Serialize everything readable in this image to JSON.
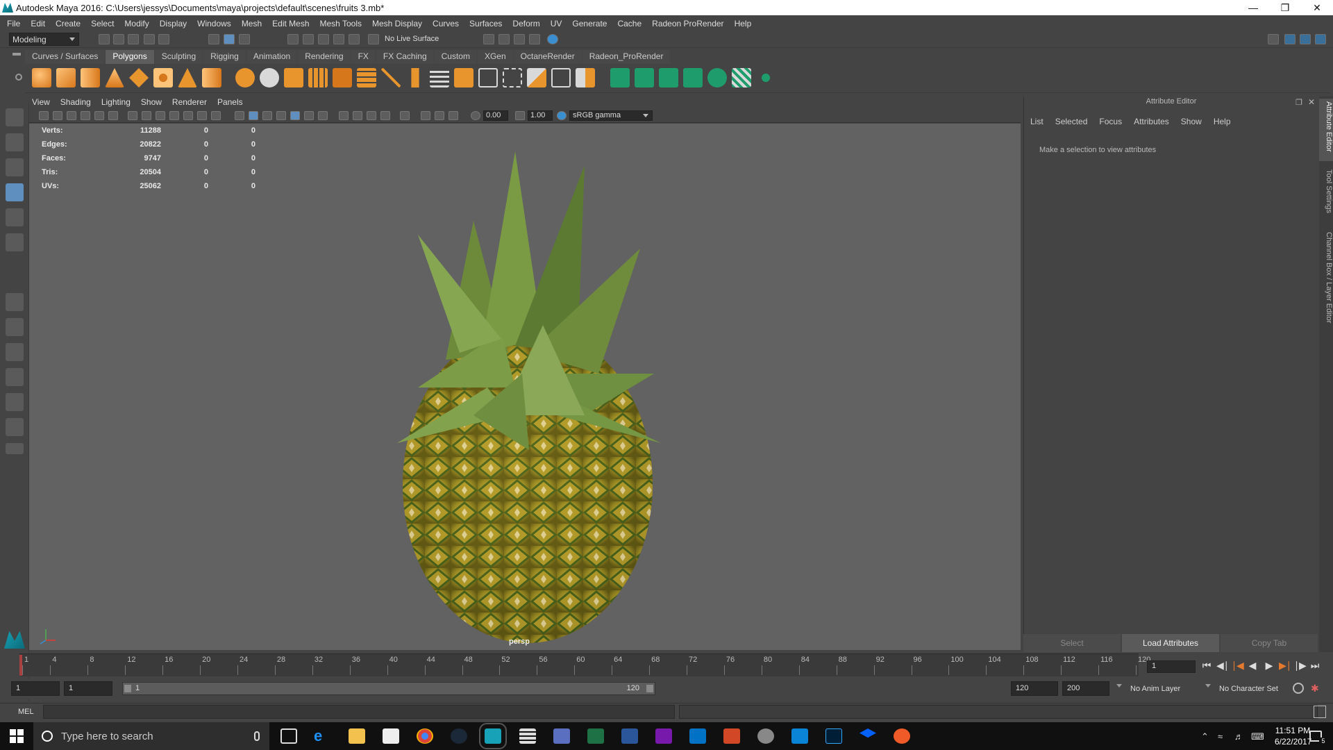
{
  "window": {
    "title": "Autodesk Maya 2016: C:\\Users\\jessys\\Documents\\maya\\projects\\default\\scenes\\fruits 3.mb*"
  },
  "menubar": [
    "File",
    "Edit",
    "Create",
    "Select",
    "Modify",
    "Display",
    "Windows",
    "Mesh",
    "Edit Mesh",
    "Mesh Tools",
    "Mesh Display",
    "Curves",
    "Surfaces",
    "Deform",
    "UV",
    "Generate",
    "Cache",
    "Radeon ProRender",
    "Help"
  ],
  "status_line": {
    "mode": "Modeling",
    "live_surface": "No Live Surface"
  },
  "shelf_tabs": [
    "Curves / Surfaces",
    "Polygons",
    "Sculpting",
    "Rigging",
    "Animation",
    "Rendering",
    "FX",
    "FX Caching",
    "Custom",
    "XGen",
    "OctaneRender",
    "Radeon_ProRender"
  ],
  "shelf_active": "Polygons",
  "viewport": {
    "menu": [
      "View",
      "Shading",
      "Lighting",
      "Show",
      "Renderer",
      "Panels"
    ],
    "exposure": "0.00",
    "gamma": "1.00",
    "color_space": "sRGB gamma",
    "camera": "persp",
    "hud": [
      {
        "label": "Verts:",
        "v1": "11288",
        "v2": "0",
        "v3": "0"
      },
      {
        "label": "Edges:",
        "v1": "20822",
        "v2": "0",
        "v3": "0"
      },
      {
        "label": "Faces:",
        "v1": "9747",
        "v2": "0",
        "v3": "0"
      },
      {
        "label": "Tris:",
        "v1": "20504",
        "v2": "0",
        "v3": "0"
      },
      {
        "label": "UVs:",
        "v1": "25062",
        "v2": "0",
        "v3": "0"
      }
    ]
  },
  "attribute_editor": {
    "title": "Attribute Editor",
    "menu": [
      "List",
      "Selected",
      "Focus",
      "Attributes",
      "Show",
      "Help"
    ],
    "message": "Make a selection to view attributes",
    "buttons": [
      "Select",
      "Load Attributes",
      "Copy Tab"
    ],
    "side_tabs": [
      "Attribute Editor",
      "Tool Settings",
      "Channel Box / Layer Editor"
    ]
  },
  "timeline": {
    "ticks": [
      "1",
      "4",
      "8",
      "12",
      "16",
      "20",
      "24",
      "28",
      "32",
      "36",
      "40",
      "44",
      "48",
      "52",
      "56",
      "60",
      "64",
      "68",
      "72",
      "76",
      "80",
      "84",
      "88",
      "92",
      "96",
      "100",
      "104",
      "108",
      "112",
      "116",
      "120"
    ],
    "current_frame": "1"
  },
  "range": {
    "start": "1",
    "playback_start": "1",
    "slider_start": "1",
    "slider_end": "120",
    "playback_end": "120",
    "end": "200",
    "anim_layer": "No Anim Layer",
    "character_set": "No Character Set"
  },
  "command_line": {
    "label": "MEL"
  },
  "taskbar": {
    "search_placeholder": "Type here to search",
    "time": "11:51 PM",
    "date": "6/22/2017",
    "notifications": "5"
  },
  "colors": {
    "accent": "#5f8fbf",
    "viewport_bg": "#626262",
    "panel": "#444444"
  }
}
